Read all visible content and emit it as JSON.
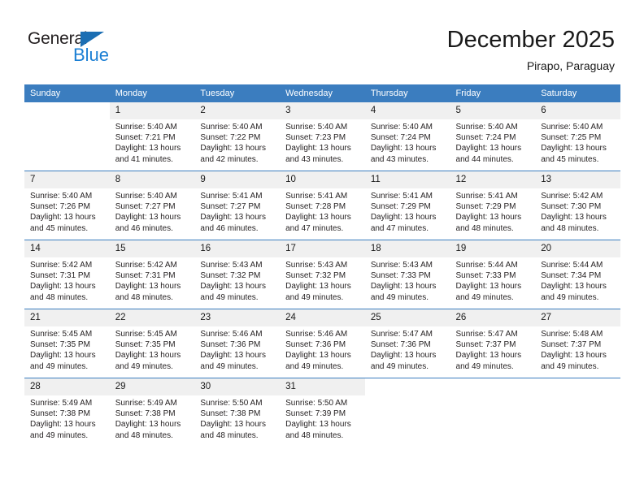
{
  "logo": {
    "text_general": "General",
    "text_blue": "Blue",
    "triangle_color": "#1b6eb3",
    "blue_color": "#1b7fd4"
  },
  "header": {
    "month_title": "December 2025",
    "location": "Pirapo, Paraguay"
  },
  "theme": {
    "header_blue": "#3b7dbf",
    "daynum_band": "#f0f0f0",
    "text": "#231f20"
  },
  "calendar": {
    "weekday_headers": [
      "Sunday",
      "Monday",
      "Tuesday",
      "Wednesday",
      "Thursday",
      "Friday",
      "Saturday"
    ],
    "weeks": [
      [
        {
          "day": "",
          "sunrise": "",
          "sunset": "",
          "daylight_1": "",
          "daylight_2": "",
          "blank": true
        },
        {
          "day": "1",
          "sunrise": "Sunrise: 5:40 AM",
          "sunset": "Sunset: 7:21 PM",
          "daylight_1": "Daylight: 13 hours",
          "daylight_2": "and 41 minutes."
        },
        {
          "day": "2",
          "sunrise": "Sunrise: 5:40 AM",
          "sunset": "Sunset: 7:22 PM",
          "daylight_1": "Daylight: 13 hours",
          "daylight_2": "and 42 minutes."
        },
        {
          "day": "3",
          "sunrise": "Sunrise: 5:40 AM",
          "sunset": "Sunset: 7:23 PM",
          "daylight_1": "Daylight: 13 hours",
          "daylight_2": "and 43 minutes."
        },
        {
          "day": "4",
          "sunrise": "Sunrise: 5:40 AM",
          "sunset": "Sunset: 7:24 PM",
          "daylight_1": "Daylight: 13 hours",
          "daylight_2": "and 43 minutes."
        },
        {
          "day": "5",
          "sunrise": "Sunrise: 5:40 AM",
          "sunset": "Sunset: 7:24 PM",
          "daylight_1": "Daylight: 13 hours",
          "daylight_2": "and 44 minutes."
        },
        {
          "day": "6",
          "sunrise": "Sunrise: 5:40 AM",
          "sunset": "Sunset: 7:25 PM",
          "daylight_1": "Daylight: 13 hours",
          "daylight_2": "and 45 minutes."
        }
      ],
      [
        {
          "day": "7",
          "sunrise": "Sunrise: 5:40 AM",
          "sunset": "Sunset: 7:26 PM",
          "daylight_1": "Daylight: 13 hours",
          "daylight_2": "and 45 minutes."
        },
        {
          "day": "8",
          "sunrise": "Sunrise: 5:40 AM",
          "sunset": "Sunset: 7:27 PM",
          "daylight_1": "Daylight: 13 hours",
          "daylight_2": "and 46 minutes."
        },
        {
          "day": "9",
          "sunrise": "Sunrise: 5:41 AM",
          "sunset": "Sunset: 7:27 PM",
          "daylight_1": "Daylight: 13 hours",
          "daylight_2": "and 46 minutes."
        },
        {
          "day": "10",
          "sunrise": "Sunrise: 5:41 AM",
          "sunset": "Sunset: 7:28 PM",
          "daylight_1": "Daylight: 13 hours",
          "daylight_2": "and 47 minutes."
        },
        {
          "day": "11",
          "sunrise": "Sunrise: 5:41 AM",
          "sunset": "Sunset: 7:29 PM",
          "daylight_1": "Daylight: 13 hours",
          "daylight_2": "and 47 minutes."
        },
        {
          "day": "12",
          "sunrise": "Sunrise: 5:41 AM",
          "sunset": "Sunset: 7:29 PM",
          "daylight_1": "Daylight: 13 hours",
          "daylight_2": "and 48 minutes."
        },
        {
          "day": "13",
          "sunrise": "Sunrise: 5:42 AM",
          "sunset": "Sunset: 7:30 PM",
          "daylight_1": "Daylight: 13 hours",
          "daylight_2": "and 48 minutes."
        }
      ],
      [
        {
          "day": "14",
          "sunrise": "Sunrise: 5:42 AM",
          "sunset": "Sunset: 7:31 PM",
          "daylight_1": "Daylight: 13 hours",
          "daylight_2": "and 48 minutes."
        },
        {
          "day": "15",
          "sunrise": "Sunrise: 5:42 AM",
          "sunset": "Sunset: 7:31 PM",
          "daylight_1": "Daylight: 13 hours",
          "daylight_2": "and 48 minutes."
        },
        {
          "day": "16",
          "sunrise": "Sunrise: 5:43 AM",
          "sunset": "Sunset: 7:32 PM",
          "daylight_1": "Daylight: 13 hours",
          "daylight_2": "and 49 minutes."
        },
        {
          "day": "17",
          "sunrise": "Sunrise: 5:43 AM",
          "sunset": "Sunset: 7:32 PM",
          "daylight_1": "Daylight: 13 hours",
          "daylight_2": "and 49 minutes."
        },
        {
          "day": "18",
          "sunrise": "Sunrise: 5:43 AM",
          "sunset": "Sunset: 7:33 PM",
          "daylight_1": "Daylight: 13 hours",
          "daylight_2": "and 49 minutes."
        },
        {
          "day": "19",
          "sunrise": "Sunrise: 5:44 AM",
          "sunset": "Sunset: 7:33 PM",
          "daylight_1": "Daylight: 13 hours",
          "daylight_2": "and 49 minutes."
        },
        {
          "day": "20",
          "sunrise": "Sunrise: 5:44 AM",
          "sunset": "Sunset: 7:34 PM",
          "daylight_1": "Daylight: 13 hours",
          "daylight_2": "and 49 minutes."
        }
      ],
      [
        {
          "day": "21",
          "sunrise": "Sunrise: 5:45 AM",
          "sunset": "Sunset: 7:35 PM",
          "daylight_1": "Daylight: 13 hours",
          "daylight_2": "and 49 minutes."
        },
        {
          "day": "22",
          "sunrise": "Sunrise: 5:45 AM",
          "sunset": "Sunset: 7:35 PM",
          "daylight_1": "Daylight: 13 hours",
          "daylight_2": "and 49 minutes."
        },
        {
          "day": "23",
          "sunrise": "Sunrise: 5:46 AM",
          "sunset": "Sunset: 7:36 PM",
          "daylight_1": "Daylight: 13 hours",
          "daylight_2": "and 49 minutes."
        },
        {
          "day": "24",
          "sunrise": "Sunrise: 5:46 AM",
          "sunset": "Sunset: 7:36 PM",
          "daylight_1": "Daylight: 13 hours",
          "daylight_2": "and 49 minutes."
        },
        {
          "day": "25",
          "sunrise": "Sunrise: 5:47 AM",
          "sunset": "Sunset: 7:36 PM",
          "daylight_1": "Daylight: 13 hours",
          "daylight_2": "and 49 minutes."
        },
        {
          "day": "26",
          "sunrise": "Sunrise: 5:47 AM",
          "sunset": "Sunset: 7:37 PM",
          "daylight_1": "Daylight: 13 hours",
          "daylight_2": "and 49 minutes."
        },
        {
          "day": "27",
          "sunrise": "Sunrise: 5:48 AM",
          "sunset": "Sunset: 7:37 PM",
          "daylight_1": "Daylight: 13 hours",
          "daylight_2": "and 49 minutes."
        }
      ],
      [
        {
          "day": "28",
          "sunrise": "Sunrise: 5:49 AM",
          "sunset": "Sunset: 7:38 PM",
          "daylight_1": "Daylight: 13 hours",
          "daylight_2": "and 49 minutes."
        },
        {
          "day": "29",
          "sunrise": "Sunrise: 5:49 AM",
          "sunset": "Sunset: 7:38 PM",
          "daylight_1": "Daylight: 13 hours",
          "daylight_2": "and 48 minutes."
        },
        {
          "day": "30",
          "sunrise": "Sunrise: 5:50 AM",
          "sunset": "Sunset: 7:38 PM",
          "daylight_1": "Daylight: 13 hours",
          "daylight_2": "and 48 minutes."
        },
        {
          "day": "31",
          "sunrise": "Sunrise: 5:50 AM",
          "sunset": "Sunset: 7:39 PM",
          "daylight_1": "Daylight: 13 hours",
          "daylight_2": "and 48 minutes."
        },
        {
          "day": "",
          "sunrise": "",
          "sunset": "",
          "daylight_1": "",
          "daylight_2": "",
          "blank": true
        },
        {
          "day": "",
          "sunrise": "",
          "sunset": "",
          "daylight_1": "",
          "daylight_2": "",
          "blank": true
        },
        {
          "day": "",
          "sunrise": "",
          "sunset": "",
          "daylight_1": "",
          "daylight_2": "",
          "blank": true
        }
      ]
    ]
  }
}
